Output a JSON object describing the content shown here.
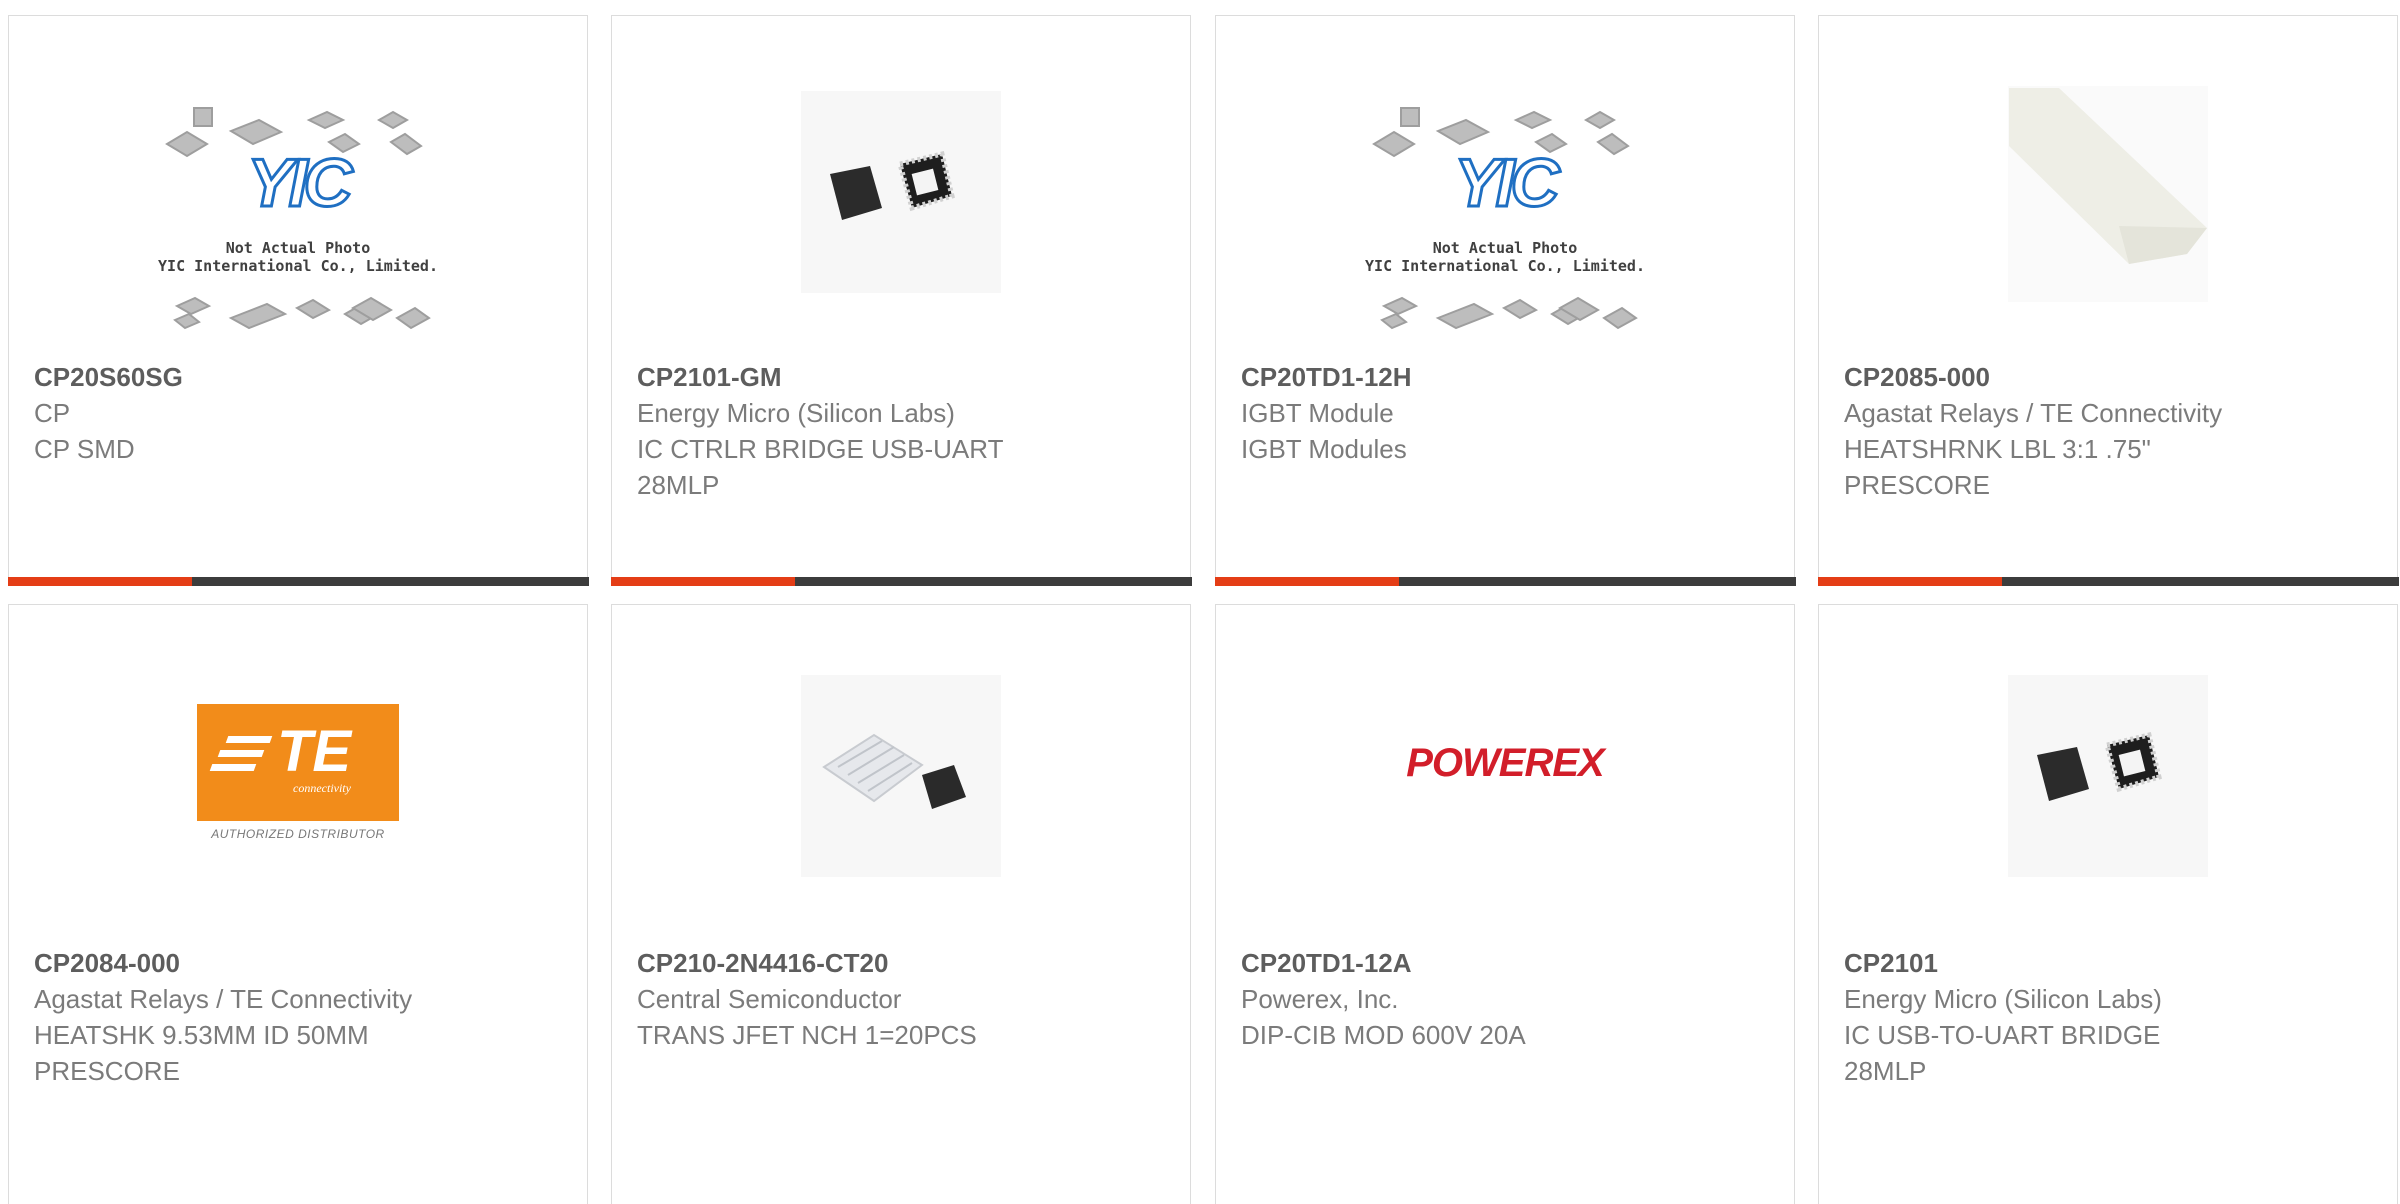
{
  "products": [
    {
      "part": "CP20S60SG",
      "lines": [
        "CP",
        "CP SMD"
      ],
      "image": "yic-not-actual-photo",
      "image_text": [
        "Not Actual Photo",
        "YIC International Co., Limited."
      ]
    },
    {
      "part": "CP2101-GM",
      "lines": [
        "Energy Micro (Silicon Labs)",
        "IC CTRLR BRIDGE USB-UART",
        "28MLP"
      ],
      "image": "qfn-chip-photo"
    },
    {
      "part": "CP20TD1-12H",
      "lines": [
        "IGBT Module",
        "IGBT Modules"
      ],
      "image": "yic-not-actual-photo",
      "image_text": [
        "Not Actual Photo",
        "YIC International Co., Limited."
      ]
    },
    {
      "part": "CP2085-000",
      "lines": [
        "Agastat Relays / TE Connectivity",
        "HEATSHRNK LBL 3:1 .75\"",
        "PRESCORE"
      ],
      "image": "heatshrink-sleeve-photo"
    },
    {
      "part": "CP2084-000",
      "lines": [
        "Agastat Relays / TE Connectivity",
        "HEATSHK 9.53MM ID 50MM",
        "PRESCORE"
      ],
      "image": "te-authorized-distributor-logo",
      "image_text": [
        "TE",
        "connectivity",
        "AUTHORIZED DISTRIBUTOR"
      ]
    },
    {
      "part": "CP210-2N4416-CT20",
      "lines": [
        "Central Semiconductor",
        "TRANS JFET NCH 1=20PCS"
      ],
      "image": "chip-tray-photo"
    },
    {
      "part": "CP20TD1-12A",
      "lines": [
        "Powerex, Inc.",
        "DIP-CIB MOD 600V 20A"
      ],
      "image": "powerex-logo",
      "image_text": [
        "POWEREX"
      ]
    },
    {
      "part": "CP2101",
      "lines": [
        "Energy Micro (Silicon Labs)",
        "IC USB-TO-UART BRIDGE",
        "28MLP"
      ],
      "image": "qfn-chip-photo"
    }
  ],
  "colors": {
    "accent": "#e43d16",
    "bar": "#3c3c3c",
    "part_text": "#5d5d5d",
    "detail_text": "#7b7b7b",
    "te_orange": "#f28c1a",
    "powerex_red": "#d21e2a"
  }
}
